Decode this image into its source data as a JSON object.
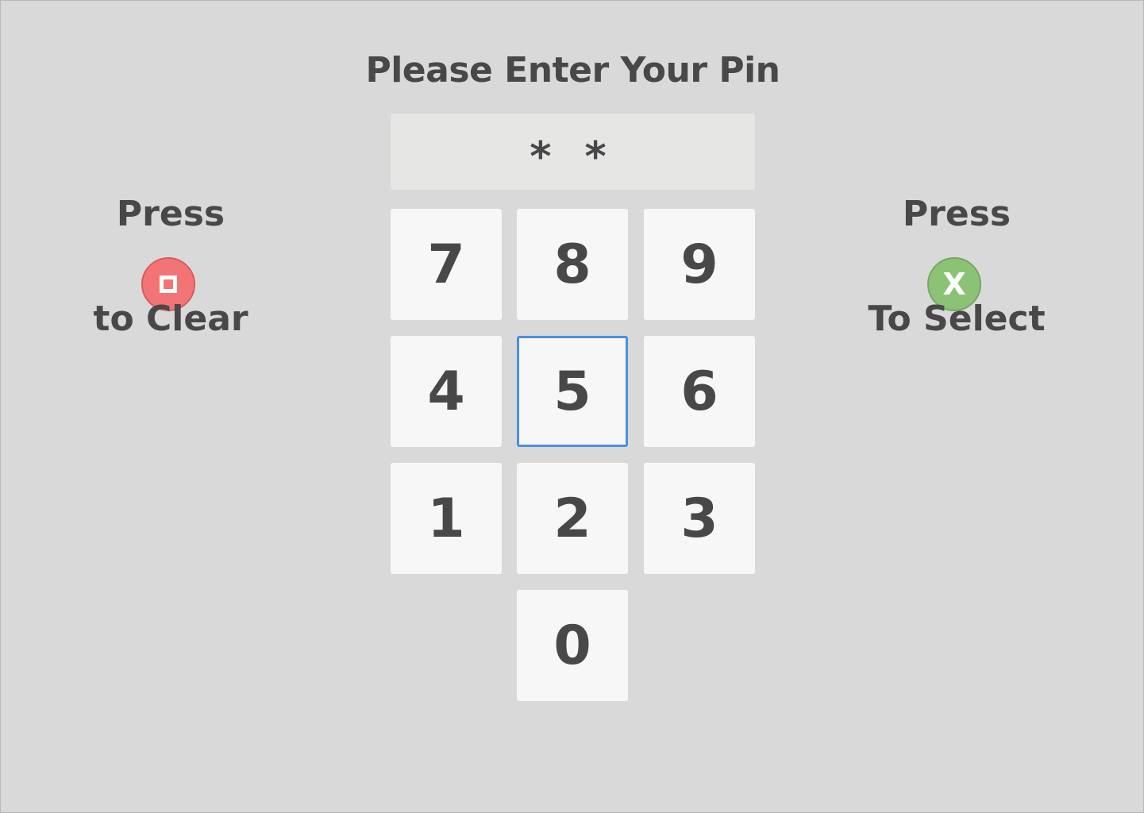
{
  "title": "Please Enter Your Pin",
  "pin_display": "* *",
  "keypad": {
    "keys": [
      "7",
      "8",
      "9",
      "4",
      "5",
      "6",
      "1",
      "2",
      "3",
      "0"
    ],
    "focused_key": "5"
  },
  "hints": {
    "clear": {
      "line1": "Press",
      "line2": "to Clear",
      "icon": "square-stop-icon",
      "color": "#f37474"
    },
    "select": {
      "line1": "Press",
      "icon_label": "X",
      "line2": "To Select",
      "color": "#8cc276"
    }
  },
  "colors": {
    "background": "#d9d9d9",
    "key_background": "#f7f7f7",
    "focus_border": "#4a90e2",
    "text": "#484848"
  }
}
